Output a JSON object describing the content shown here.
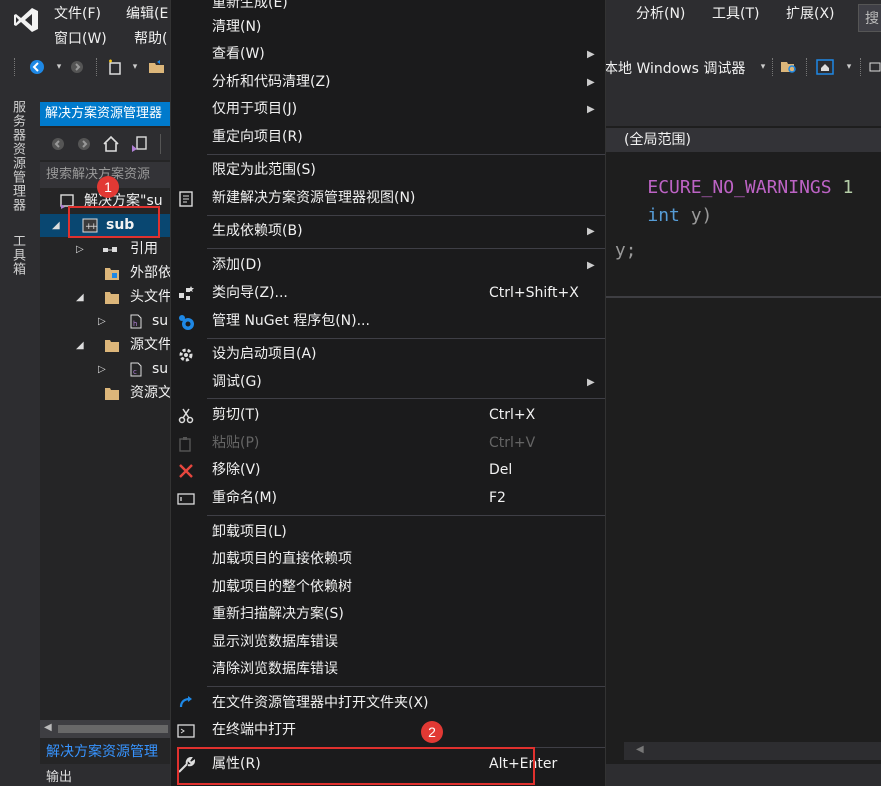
{
  "menubar": {
    "row1": [
      "文件(F)",
      "编辑(E",
      "分析(N)",
      "工具(T)",
      "扩展(X)"
    ],
    "row2": [
      "窗口(W)",
      "帮助("
    ],
    "search_placeholder": "搜"
  },
  "toolbar": {
    "debugger_label": "本地 Windows 调试器"
  },
  "side_tabs": [
    "服务器资源管理器",
    "工具箱"
  ],
  "solution_explorer": {
    "title": "解决方案资源管理器",
    "search_placeholder": "搜索解决方案资源",
    "tree": [
      {
        "label": "解决方案\"su",
        "icon": "solution-icon"
      },
      {
        "label": "sub",
        "icon": "cpp-project-icon"
      },
      {
        "label": "引用",
        "icon": "references-icon"
      },
      {
        "label": "外部依",
        "icon": "folder-icon"
      },
      {
        "label": "头文件",
        "icon": "folder-icon"
      },
      {
        "label": "su",
        "icon": "header-file-icon"
      },
      {
        "label": "源文件",
        "icon": "folder-icon"
      },
      {
        "label": "su",
        "icon": "cpp-file-icon"
      },
      {
        "label": "资源文",
        "icon": "folder-icon"
      }
    ],
    "footer_tab": "解决方案资源管理"
  },
  "editor": {
    "scope": "(全局范围)",
    "lines": [
      {
        "text": "ECURE_NO_WARNINGS ",
        "num": "1"
      },
      {
        "text_kw": "int",
        "text_rest": " y)"
      },
      {
        "text": " y;"
      }
    ]
  },
  "output_tab": "输出",
  "context_menu": {
    "items": [
      {
        "label": "重新生成(E)",
        "shortcut": "",
        "submenu": false
      },
      {
        "label": "清理(N)",
        "shortcut": "",
        "submenu": false
      },
      {
        "label": "查看(W)",
        "shortcut": "",
        "submenu": true
      },
      {
        "label": "分析和代码清理(Z)",
        "shortcut": "",
        "submenu": true
      },
      {
        "label": "仅用于项目(J)",
        "shortcut": "",
        "submenu": true
      },
      {
        "label": "重定向项目(R)",
        "shortcut": "",
        "submenu": false
      },
      {
        "label": "限定为此范围(S)",
        "shortcut": "",
        "submenu": false
      },
      {
        "label": "新建解决方案资源管理器视图(N)",
        "shortcut": "",
        "submenu": false
      },
      {
        "label": "生成依赖项(B)",
        "shortcut": "",
        "submenu": true
      },
      {
        "label": "添加(D)",
        "shortcut": "",
        "submenu": true
      },
      {
        "label": "类向导(Z)...",
        "shortcut": "Ctrl+Shift+X",
        "submenu": false
      },
      {
        "label": "管理 NuGet 程序包(N)...",
        "shortcut": "",
        "submenu": false
      },
      {
        "label": "设为启动项目(A)",
        "shortcut": "",
        "submenu": false
      },
      {
        "label": "调试(G)",
        "shortcut": "",
        "submenu": true
      },
      {
        "label": "剪切(T)",
        "shortcut": "Ctrl+X",
        "submenu": false
      },
      {
        "label": "粘贴(P)",
        "shortcut": "Ctrl+V",
        "submenu": false,
        "disabled": true
      },
      {
        "label": "移除(V)",
        "shortcut": "Del",
        "submenu": false
      },
      {
        "label": "重命名(M)",
        "shortcut": "F2",
        "submenu": false
      },
      {
        "label": "卸载项目(L)",
        "shortcut": "",
        "submenu": false
      },
      {
        "label": "加载项目的直接依赖项",
        "shortcut": "",
        "submenu": false
      },
      {
        "label": "加载项目的整个依赖树",
        "shortcut": "",
        "submenu": false
      },
      {
        "label": "重新扫描解决方案(S)",
        "shortcut": "",
        "submenu": false
      },
      {
        "label": "显示浏览数据库错误",
        "shortcut": "",
        "submenu": false
      },
      {
        "label": "清除浏览数据库错误",
        "shortcut": "",
        "submenu": false
      },
      {
        "label": "在文件资源管理器中打开文件夹(X)",
        "shortcut": "",
        "submenu": false
      },
      {
        "label": "在终端中打开",
        "shortcut": "",
        "submenu": false
      },
      {
        "label": "属性(R)",
        "shortcut": "Alt+Enter",
        "submenu": false
      }
    ]
  },
  "annotations": [
    "1",
    "2"
  ],
  "colors": {
    "accent": "#007acc",
    "annotation_red": "#e0312e",
    "keyword_blue": "#569cd6",
    "macro_purple": "#bd63c5"
  }
}
